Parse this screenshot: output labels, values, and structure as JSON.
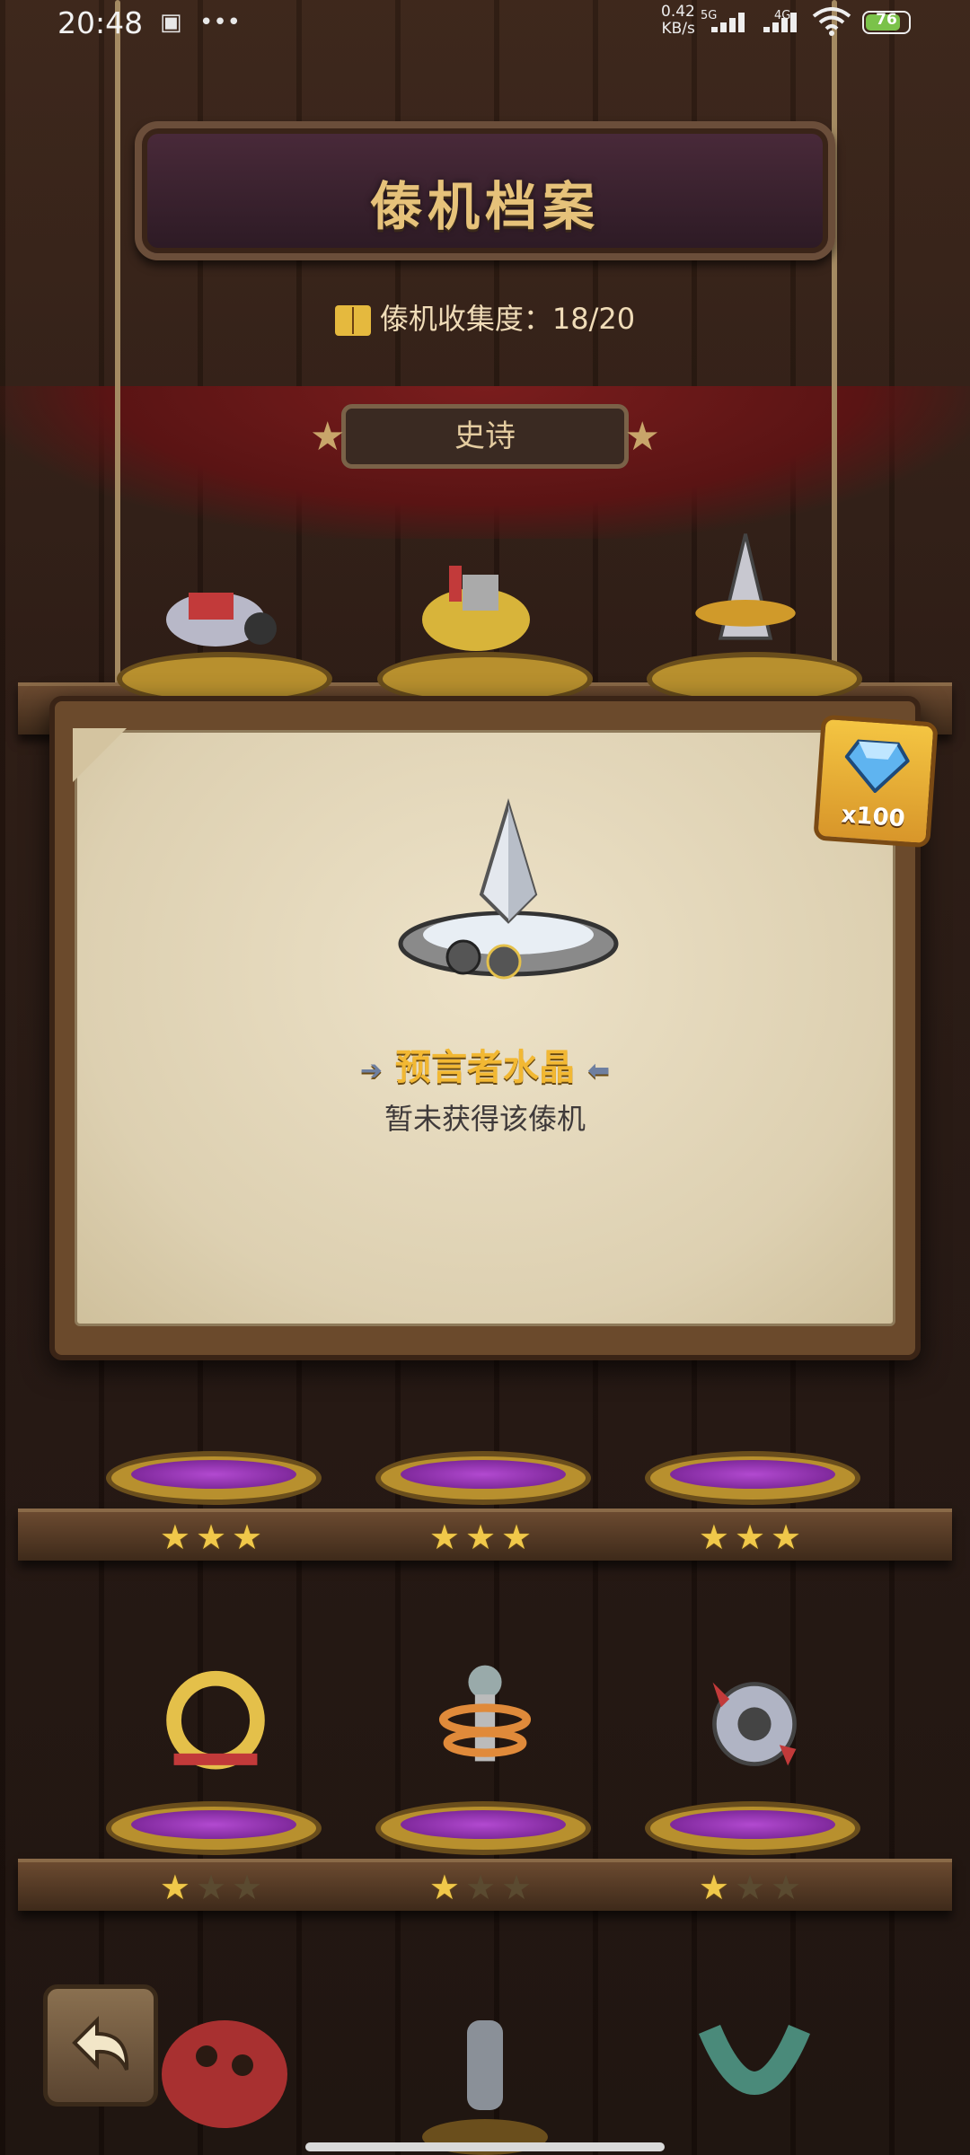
{
  "status_bar": {
    "time": "20:48",
    "net_speed_value": "0.42",
    "net_speed_unit": "KB/s",
    "signal_1": "5G",
    "signal_2": "4G",
    "battery": "76"
  },
  "header": {
    "title": "傣机档案",
    "collection_label": "傣机收集度：",
    "collection_value": "18/20",
    "rarity_tab": "史诗"
  },
  "detail_card": {
    "name": "预言者水晶",
    "status": "暂未获得该傣机",
    "price_qty": "x100",
    "price_icon": "diamond-gem-icon"
  },
  "shelves": {
    "row2_stars": [
      3,
      3,
      3
    ],
    "row3_stars": [
      1,
      1,
      1
    ]
  },
  "colors": {
    "accent_gold": "#f2b833",
    "title_gold": "#e6c27a",
    "gem_blue": "#5fb4f0"
  }
}
